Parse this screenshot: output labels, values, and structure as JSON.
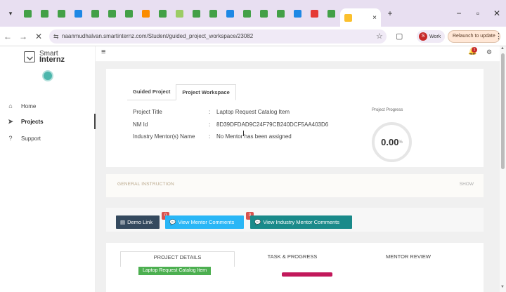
{
  "browser": {
    "active_tab_close": "×",
    "new_tab": "+",
    "url": "naanmudhalvan.smartinternz.com/Student/guided_project_workspace/23082",
    "profile_initial": "S",
    "profile_label": "Work",
    "relaunch_label": "Relaunch to update",
    "tab_icon_colors": [
      "#43a047",
      "#43a047",
      "#43a047",
      "#1e88e5",
      "#43a047",
      "#43a047",
      "#43a047",
      "#fb8c00",
      "#43a047",
      "#9ccc65",
      "#43a047",
      "#43a047",
      "#1e88e5",
      "#43a047",
      "#43a047",
      "#43a047",
      "#1e88e5",
      "#e53935",
      "#43a047",
      "#fbc02d"
    ]
  },
  "sidebar": {
    "logo_line1": "Smart",
    "logo_line2": "Internz",
    "items": [
      {
        "label": "Home",
        "icon": "home-icon"
      },
      {
        "label": "Projects",
        "icon": "send-icon"
      },
      {
        "label": "Support",
        "icon": "question-icon"
      }
    ]
  },
  "header": {
    "notification_count": "1"
  },
  "workspace": {
    "tabs": [
      "Guided Project",
      "Project Workspace"
    ],
    "fields": [
      {
        "label": "Project Title",
        "value": "Laptop Request Catalog Item"
      },
      {
        "label": "NM Id",
        "value": "8D39DFDAD9C24F79CB240DCF5AA403D6"
      },
      {
        "label": "Industry Mentor(s) Name",
        "value": "No Mentor has been assigned"
      }
    ],
    "progress_label": "Project Progress",
    "progress_value": "0.00",
    "progress_unit": "%",
    "progress_fraction": 0.0
  },
  "instruction": {
    "title": "GENERAL INSTRUCTION",
    "toggle": "SHOW"
  },
  "actions": {
    "demo_link": "Demo Link",
    "mentor_comments": "View Mentor Comments",
    "mentor_badge": "0",
    "industry_comments": "View Industry Mentor Comments",
    "industry_badge": "0"
  },
  "details": {
    "tabs": [
      "PROJECT DETAILS",
      "TASK & PROGRESS",
      "MENTOR REVIEW"
    ],
    "item_button": "Laptop Request Catalog Item"
  },
  "colors": {
    "demo_btn": "#34495e",
    "mentor_btn": "#29b6f6",
    "industry_btn": "#1a8a8a",
    "badge": "#d9534f"
  }
}
